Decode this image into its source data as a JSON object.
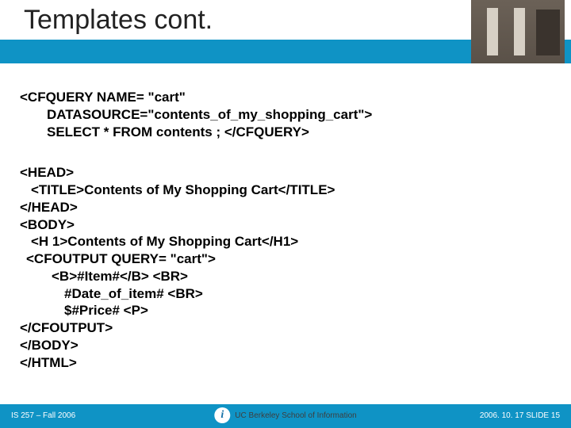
{
  "title": "Templates cont.",
  "code": {
    "l1": "<CFQUERY NAME= \"cart\"",
    "l2": "DATASOURCE=\"contents_of_my_shopping_cart\">",
    "l3": "SELECT * FROM contents ;  </CFQUERY>",
    "l4": "<HEAD>",
    "l5": "<TITLE>Contents of My Shopping Cart</TITLE>",
    "l6": "</HEAD>",
    "l7": "<BODY>",
    "l8": "<H 1>Contents of My Shopping Cart</H1>",
    "l9": "<CFOUTPUT QUERY= \"cart\">",
    "l10": "<B>#Item#</B> <BR>",
    "l11": "#Date_of_item# <BR>",
    "l12": "$#Price# <P>",
    "l13": "</CFOUTPUT>",
    "l14": "</BODY>",
    "l15": "</HTML>"
  },
  "footer": {
    "left": "IS 257 – Fall 2006",
    "center": "UC Berkeley School of Information",
    "right": "2006. 10. 17 SLIDE 15"
  }
}
